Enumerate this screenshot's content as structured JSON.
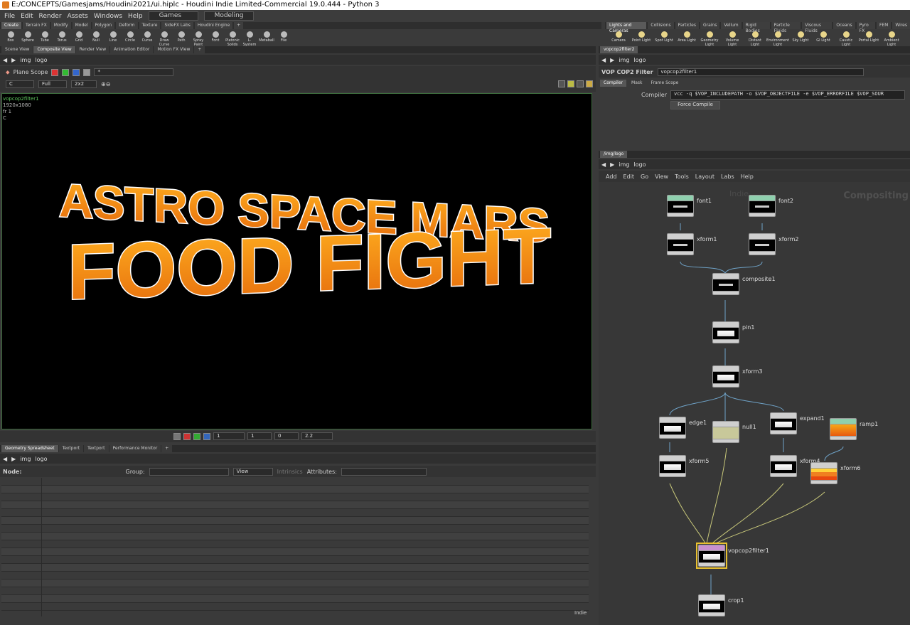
{
  "window": {
    "title": "E:/CONCEPTS/Gamesjams/Houdini2021/ui.hiplc - Houdini Indie Limited-Commercial 19.0.444 - Python 3"
  },
  "menu": {
    "items": [
      "File",
      "Edit",
      "Render",
      "Assets",
      "Windows",
      "Help"
    ],
    "desktop": "Games",
    "context": "Modeling"
  },
  "shelf_left": {
    "tabs": [
      "Create",
      "Terrain FX",
      "Modify",
      "Model",
      "Polygon",
      "Deform",
      "Texture",
      "SideFX Labs",
      "Houdini Engine",
      "+"
    ],
    "tools": [
      "Box",
      "Sphere",
      "Tube",
      "Torus",
      "Grid",
      "Null",
      "Line",
      "Circle",
      "Curve",
      "Draw Curve",
      "Path",
      "Spray Paint",
      "Font",
      "Platonic Solids",
      "L-System",
      "Metaball",
      "File"
    ]
  },
  "shelf_right": {
    "tabs": [
      "Lights and Cameras",
      "Collisions",
      "Particles",
      "Grains",
      "Vellum",
      "Rigid Bodies",
      "Particle Fluids",
      "Viscous Fluids",
      "Oceans",
      "Pyro FX",
      "FEM",
      "Wires"
    ],
    "tools": [
      "Camera",
      "Point Light",
      "Spot Light",
      "Area Light",
      "Geometry Light",
      "Volume Light",
      "Distant Light",
      "Environment Light",
      "Sky Light",
      "GI Light",
      "Caustic Light",
      "Portal Light",
      "Ambient Light"
    ]
  },
  "viewer_tabs": [
    "Scene View",
    "Composite View",
    "Render View",
    "Animation Editor",
    "Motion FX View",
    "+"
  ],
  "viewer_path": {
    "root": "img",
    "node": "logo"
  },
  "viewer_toolbar": {
    "scope": "Plane Scope",
    "scope_value": "*",
    "plane": "C",
    "res": "Full",
    "split": "2x2"
  },
  "viewer_info": {
    "node": "vopcop2filter1",
    "res": "1920x1080",
    "frame": "fr 1",
    "plane": "C"
  },
  "logo_text": {
    "line1": "ASTRO SPACE MARS",
    "line2": "FOOD FIGHT"
  },
  "playbar": {
    "frame": "1",
    "step": "1",
    "offset": "0",
    "gamma": "2.2"
  },
  "spreadsheet": {
    "tabs": [
      "Geometry Spreadsheet",
      "Textport",
      "Textport",
      "Performance Monitor",
      "+"
    ],
    "node_label": "Node:",
    "group_label": "Group:",
    "view_label": "View",
    "intrinsics": "Intrinsics",
    "attributes_label": "Attributes:"
  },
  "status": {
    "indie": "Indie"
  },
  "param": {
    "tab": "vopcop2filter2",
    "path_root": "img",
    "path_node": "logo",
    "type": "VOP COP2 Filter",
    "name": "vopcop2filter1",
    "subtabs": [
      "Compiler",
      "Mask",
      "Frame Scope"
    ],
    "compiler_label": "Compiler",
    "compiler_value": "vcc -q $VOP_INCLUDEPATH -o $VOP_OBJECTFILE -e $VOP_ERRORFILE $VOP_SOUR",
    "force_compile": "Force Compile"
  },
  "network": {
    "tab": "/img/logo",
    "path_root": "img",
    "path_node": "logo",
    "menu": [
      "Add",
      "Edit",
      "Go",
      "View",
      "Tools",
      "Layout",
      "Labs",
      "Help"
    ],
    "watermark_indie": "Indie",
    "watermark_ctx": "Compositing",
    "nodes": [
      "font1",
      "font2",
      "xform1",
      "xform2",
      "composite1",
      "pin1",
      "xform3",
      "edge1",
      "null1",
      "expand1",
      "ramp1",
      "xform5",
      "xform4",
      "xform6",
      "vopcop2filter1",
      "crop1"
    ]
  }
}
